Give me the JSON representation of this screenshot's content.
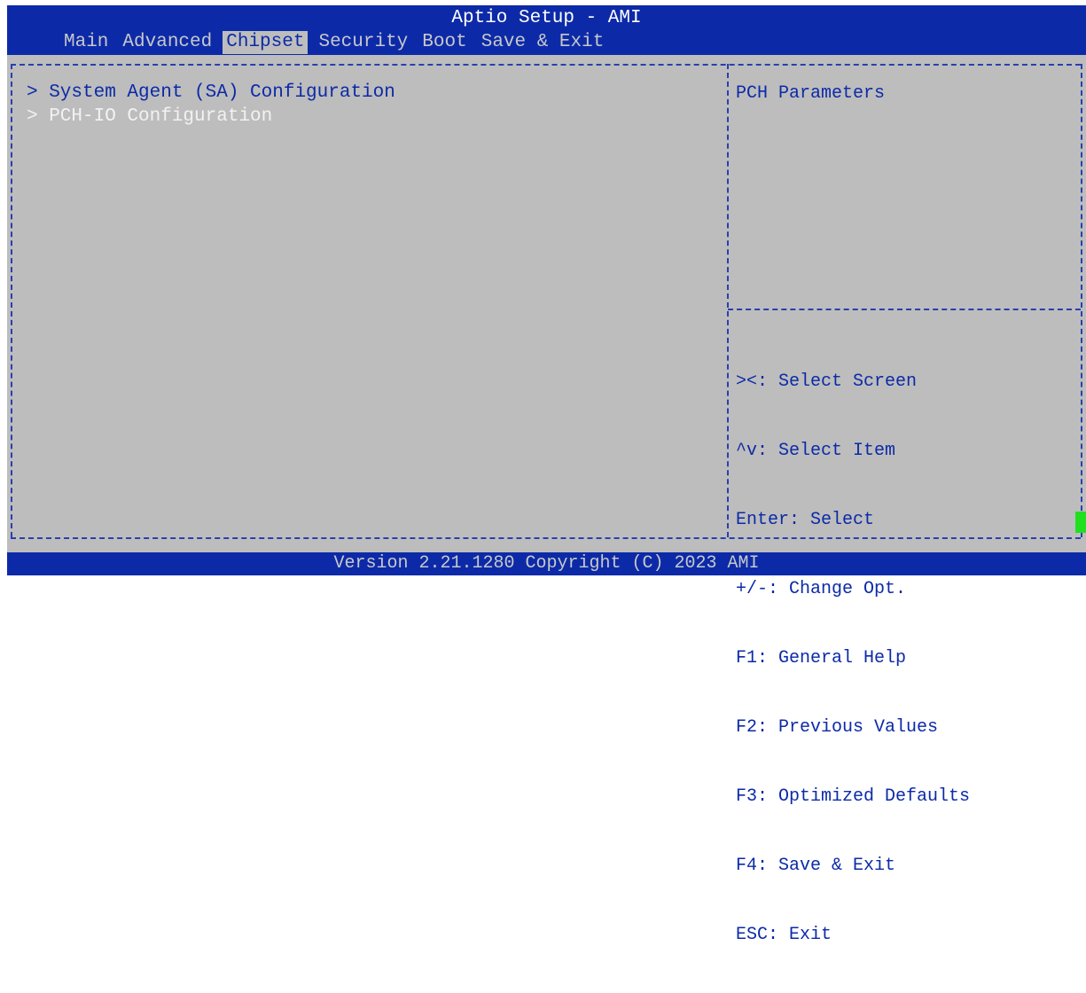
{
  "header": {
    "title": "Aptio Setup - AMI",
    "tabs": [
      "Main",
      "Advanced",
      "Chipset",
      "Security",
      "Boot",
      "Save & Exit"
    ],
    "active_tab": "Chipset"
  },
  "menu": {
    "items": [
      {
        "label": "> System Agent (SA) Configuration",
        "highlighted": false
      },
      {
        "label": "> PCH-IO Configuration",
        "highlighted": true
      }
    ]
  },
  "help": {
    "description": "PCH Parameters",
    "keys": [
      "><: Select Screen",
      "^v: Select Item",
      "Enter: Select",
      "+/-: Change Opt.",
      "F1: General Help",
      "F2: Previous Values",
      "F3: Optimized Defaults",
      "F4: Save & Exit",
      "ESC: Exit"
    ]
  },
  "footer": {
    "text": "Version 2.21.1280 Copyright (C) 2023 AMI"
  },
  "colors": {
    "background": "#bdbdbd",
    "bar": "#0c2aa8",
    "text_blue": "#0c2aa8",
    "highlight_text": "#f2f2f2",
    "cursor": "#20e020"
  }
}
